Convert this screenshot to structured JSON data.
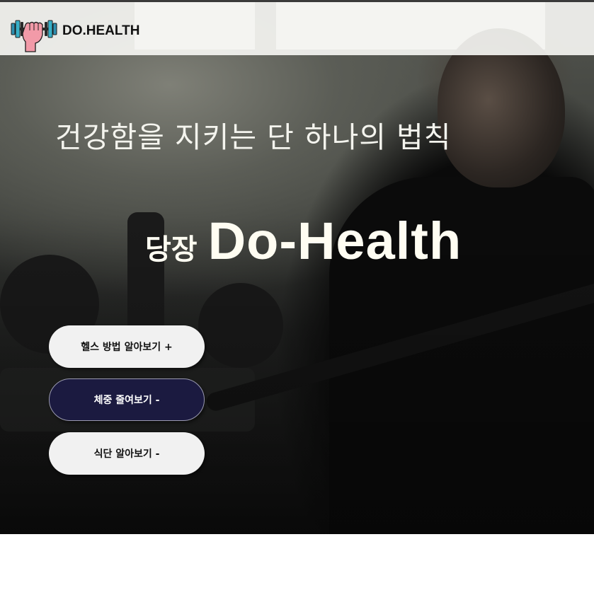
{
  "header": {
    "logo_text": "DO.HEALTH",
    "logo_icon": "dumbbell-fist-icon",
    "colors": {
      "bar_bg": "#f5f5f2",
      "dumbbell_plate": "#2f8fb0",
      "fist": "#f29aa8"
    }
  },
  "hero": {
    "headline": "건강함을 지키는 단 하나의 법칙",
    "brand_prefix": "당장",
    "brand_name": "Do-Health",
    "background": "gym-photo"
  },
  "menu": {
    "buttons": [
      {
        "label": "헬스 방법 알아보기 +",
        "style": "light"
      },
      {
        "label": "체중 줄여보기 -",
        "style": "dark"
      },
      {
        "label": "식단 알아보기 -",
        "style": "light"
      }
    ],
    "colors": {
      "light_bg": "#f1f1f1",
      "dark_bg": "#1b1a40"
    }
  }
}
